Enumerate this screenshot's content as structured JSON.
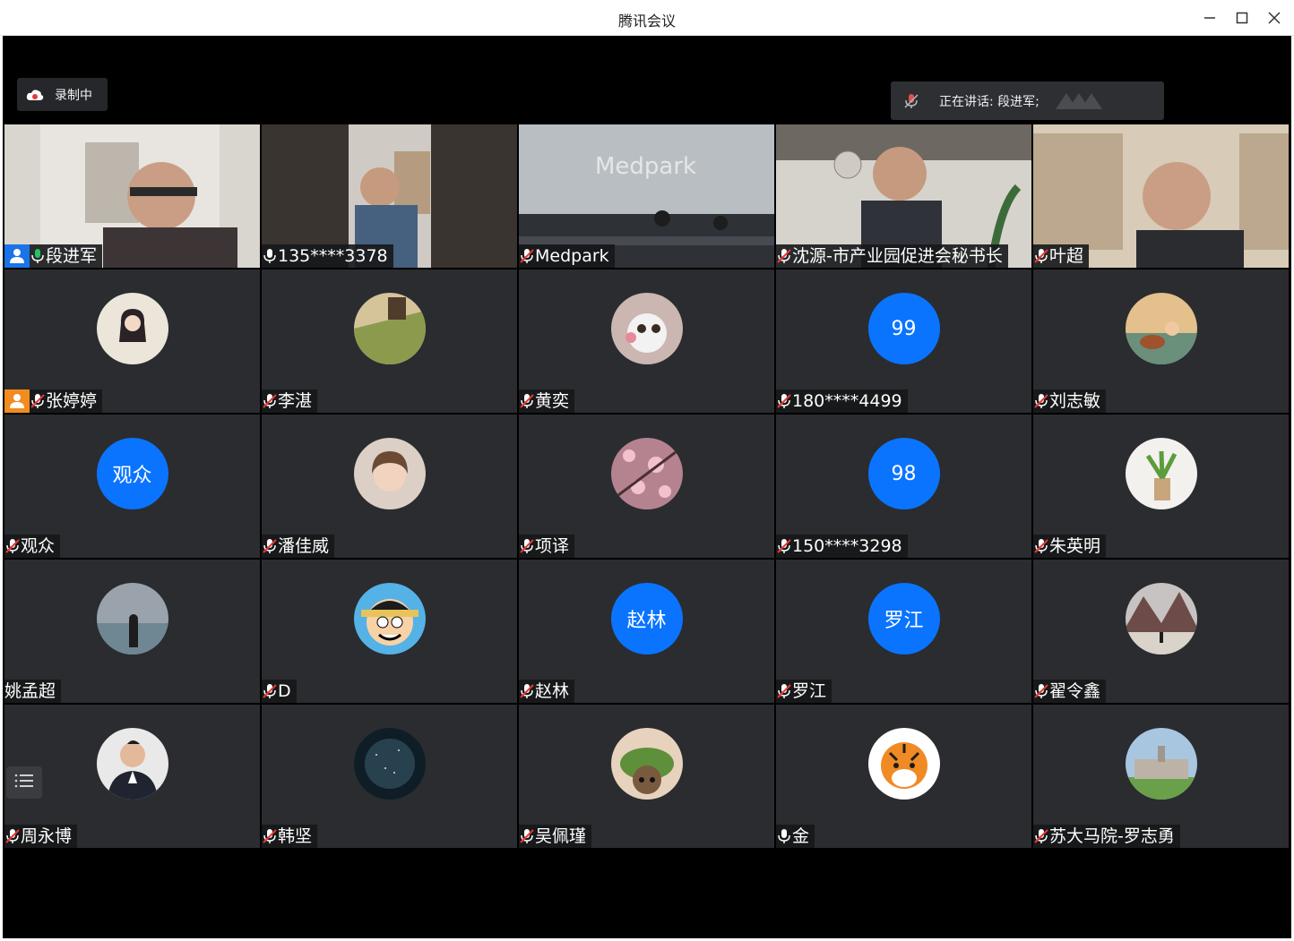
{
  "window": {
    "title": "腾讯会议",
    "controls": [
      "minimize-icon",
      "maximize-icon",
      "close-icon"
    ]
  },
  "recording": {
    "label": "录制中",
    "icon": "cloud-record-icon"
  },
  "speaking": {
    "label": "正在讲话: 段进军;",
    "icon": "mic-muted-icon"
  },
  "colors": {
    "accent": "#0a74ff",
    "active_border": "#21c55d",
    "host_badge": "#1a73e8",
    "cohost_badge": "#f28b20"
  },
  "participants": [
    {
      "name": "段进军",
      "mic": "mic-on-green",
      "badge": "host",
      "type": "video"
    },
    {
      "name": "135****3378",
      "mic": "mic-on",
      "type": "video"
    },
    {
      "name": "Medpark",
      "mic": "mic-muted",
      "type": "video"
    },
    {
      "name": "沈源-市产业园促进会秘书长",
      "mic": "mic-muted",
      "type": "video"
    },
    {
      "name": "叶超",
      "mic": "mic-muted",
      "type": "video"
    },
    {
      "name": "张婷婷",
      "mic": "mic-muted",
      "badge": "cohost",
      "type": "avatar",
      "avatar_icon": "woman-photo-avatar"
    },
    {
      "name": "李湛",
      "mic": "mic-muted",
      "type": "avatar",
      "avatar_icon": "landscape-photo-avatar"
    },
    {
      "name": "黄奕",
      "mic": "mic-muted",
      "type": "avatar",
      "avatar_icon": "cat-photo-avatar"
    },
    {
      "name": "180****4499",
      "mic": "mic-muted",
      "type": "text-avatar",
      "avatar_text": "99"
    },
    {
      "name": "刘志敏",
      "mic": "mic-muted",
      "type": "avatar",
      "avatar_icon": "guitar-illustration-avatar"
    },
    {
      "name": "观众",
      "mic": "mic-muted",
      "type": "text-avatar",
      "avatar_text": "观众"
    },
    {
      "name": "潘佳威",
      "mic": "mic-muted",
      "type": "avatar",
      "avatar_icon": "girl-photo-avatar"
    },
    {
      "name": "项译",
      "mic": "mic-muted",
      "type": "avatar",
      "avatar_icon": "blossom-photo-avatar"
    },
    {
      "name": "150****3298",
      "mic": "mic-muted",
      "type": "text-avatar",
      "avatar_text": "98"
    },
    {
      "name": "朱英明",
      "mic": "mic-muted",
      "type": "avatar",
      "avatar_icon": "plant-photo-avatar"
    },
    {
      "name": "姚孟超",
      "mic": "none",
      "type": "avatar",
      "avatar_icon": "sea-photo-avatar"
    },
    {
      "name": "D",
      "mic": "mic-muted",
      "type": "avatar",
      "avatar_icon": "cartoon-avatar"
    },
    {
      "name": "赵林",
      "mic": "mic-muted",
      "type": "text-avatar",
      "avatar_text": "赵林"
    },
    {
      "name": "罗江",
      "mic": "mic-muted",
      "type": "text-avatar",
      "avatar_text": "罗江"
    },
    {
      "name": "翟令鑫",
      "mic": "mic-muted",
      "type": "avatar",
      "avatar_icon": "mountain-photo-avatar"
    },
    {
      "name": "周永博",
      "mic": "mic-muted",
      "type": "avatar",
      "avatar_icon": "man-suit-photo-avatar"
    },
    {
      "name": "韩坚",
      "mic": "mic-muted",
      "type": "avatar",
      "avatar_icon": "starry-photo-avatar"
    },
    {
      "name": "吴佩瑾",
      "mic": "mic-muted",
      "type": "avatar",
      "avatar_icon": "frog-hat-photo-avatar"
    },
    {
      "name": "金",
      "mic": "mic-on",
      "type": "avatar",
      "avatar_icon": "tiger-avatar"
    },
    {
      "name": "苏大马院-罗志勇",
      "mic": "mic-muted",
      "type": "avatar",
      "avatar_icon": "campus-photo-avatar"
    }
  ],
  "floating_menu": {
    "icon": "list-menu-icon"
  }
}
